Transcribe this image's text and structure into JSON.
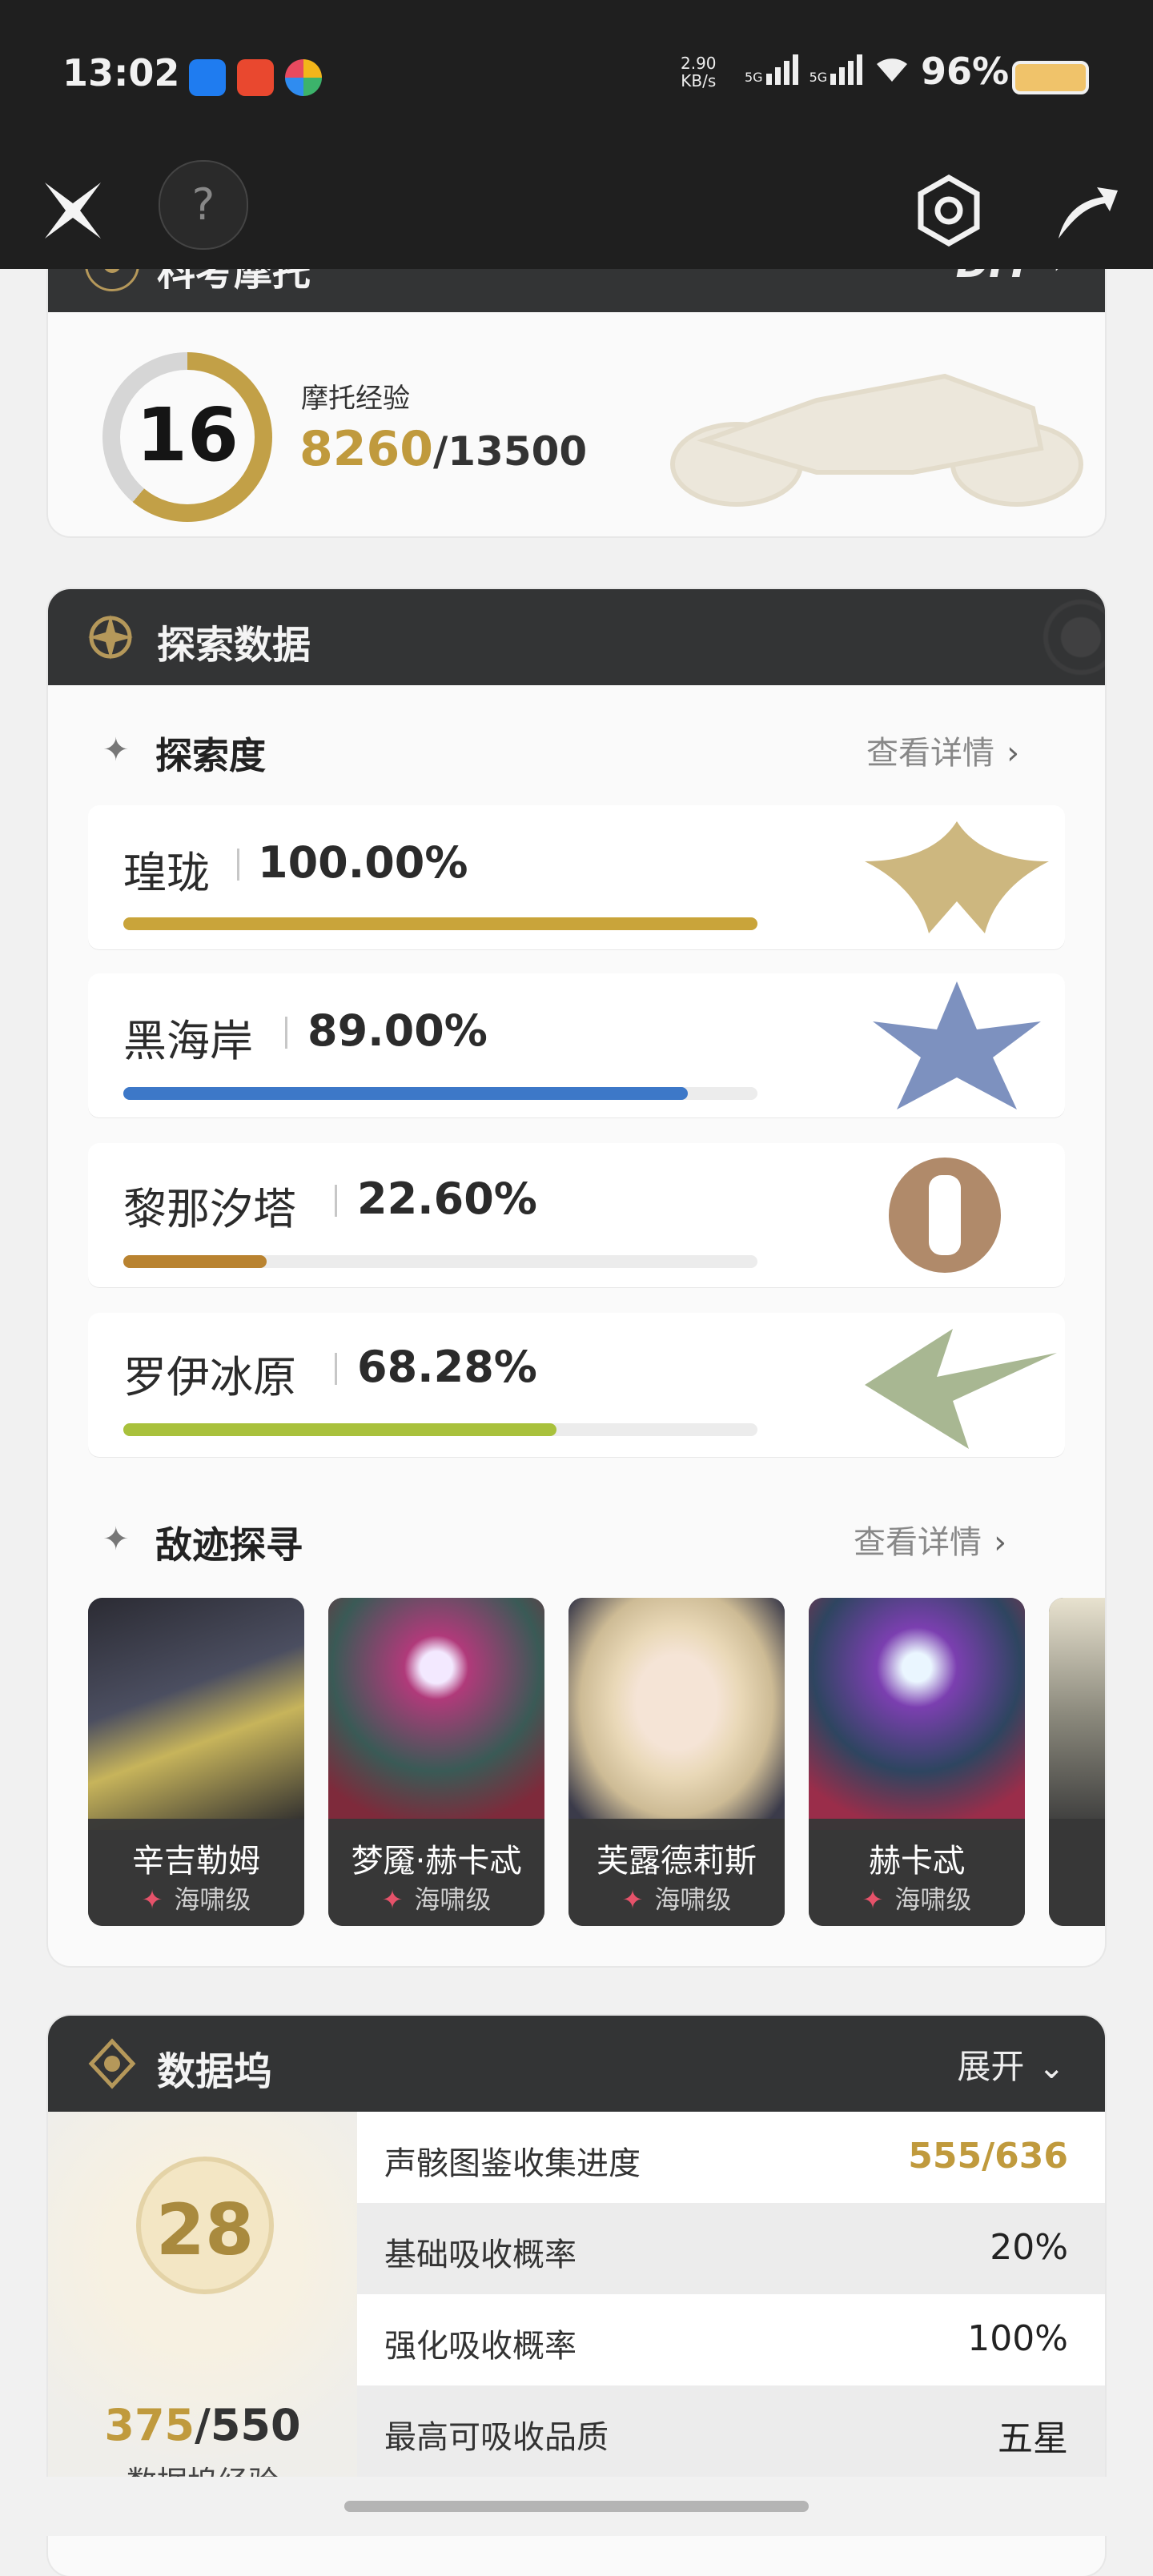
{
  "status_bar": {
    "time": "13:02",
    "net_speed_value": "2.90",
    "net_speed_unit": "KB/s",
    "sim1": "5G",
    "sim2": "5G",
    "battery": "96%"
  },
  "nav": {
    "help_label": "?"
  },
  "moto": {
    "header_title": "科考摩托",
    "header_badge": "DIY",
    "level": "16",
    "exp_label": "摩托经验",
    "exp_current": "8260",
    "exp_total": "/13500"
  },
  "explore": {
    "header_title": "探索数据",
    "exploration": {
      "title": "探索度",
      "detail_link": "查看详情",
      "regions": [
        {
          "name": "瑝珑",
          "percent_text": "100.00%",
          "percent": 100.0,
          "color": "#c9a43a"
        },
        {
          "name": "黑海岸",
          "percent_text": "89.00%",
          "percent": 89.0,
          "color": "#3d78c8"
        },
        {
          "name": "黎那汐塔",
          "percent_text": "22.60%",
          "percent": 22.6,
          "color": "#b98330"
        },
        {
          "name": "罗伊冰原",
          "percent_text": "68.28%",
          "percent": 68.28,
          "color": "#a9c13c"
        }
      ]
    },
    "enemies": {
      "title": "敌迹探寻",
      "detail_link": "查看详情",
      "items": [
        {
          "name": "辛吉勒姆",
          "tier": "海啸级"
        },
        {
          "name": "梦魇·赫卡忒",
          "tier": "海啸级"
        },
        {
          "name": "芙露德莉斯",
          "tier": "海啸级"
        },
        {
          "name": "赫卡忒",
          "tier": "海啸级"
        }
      ]
    }
  },
  "dock": {
    "header_title": "数据坞",
    "expand_label": "展开",
    "level": "28",
    "exp_current": "375",
    "exp_total": "/550",
    "exp_label": "数据坞经验",
    "stats": [
      {
        "label": "声骸图鉴收集进度",
        "value": "555/636",
        "highlight": true
      },
      {
        "label": "基础吸收概率",
        "value": "20%",
        "highlight": false
      },
      {
        "label": "强化吸收概率",
        "value": "100%",
        "highlight": false
      },
      {
        "label": "最高可吸收品质",
        "value": "五星",
        "highlight": false
      }
    ]
  }
}
